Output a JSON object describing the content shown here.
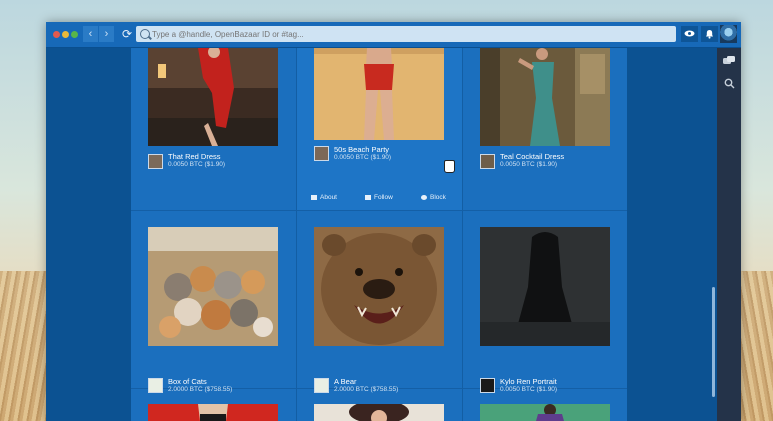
{
  "toolbar": {
    "back_glyph": "‹",
    "forward_glyph": "›",
    "refresh_glyph": "⟳",
    "address_placeholder": "Type a @handle, OpenBazaar ID or #tag...",
    "icons": [
      "search-icon",
      "eye-icon",
      "bell-icon",
      "chat-icon"
    ]
  },
  "listings": [
    {
      "title": "That Red Dress",
      "price": "0.0050 BTC ($1.90)",
      "image": "woman in red dress"
    },
    {
      "title": "50s Beach Party",
      "price": "0.0050 BTC ($1.90)",
      "image": "woman in red swimsuit"
    },
    {
      "title": "Teal Cocktail Dress",
      "price": "0.0050 BTC ($1.90)",
      "image": "woman in teal dress"
    },
    {
      "title": "Box of Cats",
      "price": "2.0000 BTC ($758.55)",
      "image": "box full of kittens"
    },
    {
      "title": "A Bear",
      "price": "2.0000 BTC ($758.55)",
      "image": "roaring brown bear"
    },
    {
      "title": "Kylo Ren Portrait",
      "price": "0.0050 BTC ($1.90)",
      "image": "dark hooded figure"
    }
  ],
  "card_actions": {
    "about": "About",
    "follow": "Follow",
    "block": "Block"
  },
  "colors": {
    "window_blue": "#1b6fbe",
    "topbar": "#1769b8",
    "side_panel": "#243349"
  }
}
